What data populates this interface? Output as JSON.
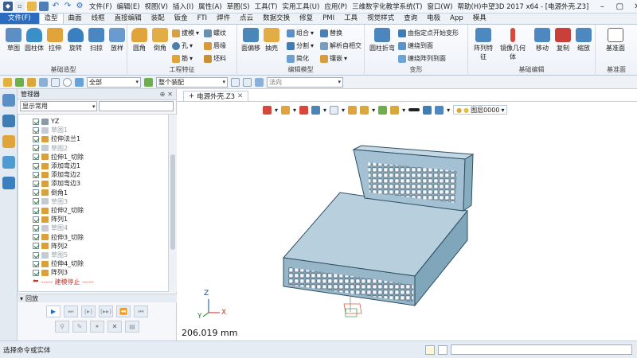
{
  "titlebar": {
    "menus": [
      "文件(F)",
      "编辑(E)",
      "视图(V)",
      "插入(I)",
      "属性(A)",
      "草图(S)",
      "工具(T)",
      "实用工具(U)",
      "应用(P)",
      "三维数字化教学系统(T)",
      "窗口(W)",
      "帮助(H)"
    ],
    "app_title": "中望3D 2017  x64 - [电源外壳.Z3]"
  },
  "tabs": {
    "file": "文件(F)",
    "items": [
      "造型",
      "曲面",
      "线框",
      "直接编辑",
      "装配",
      "钣金",
      "FTI",
      "焊件",
      "点云",
      "数据交换",
      "修复",
      "PMI",
      "工具",
      "视觉样式",
      "查询",
      "电极",
      "App",
      "模具"
    ],
    "active_index": 0
  },
  "ribbon": {
    "basic": {
      "label": "基础造型",
      "buttons": [
        "草图",
        "圆柱体",
        "拉伸",
        "旋转",
        "扫掠",
        "放样"
      ]
    },
    "engineering": {
      "label": "工程特征",
      "big_buttons": [
        "圆角",
        "倒角"
      ],
      "small_buttons": [
        "拔模",
        "孔",
        "筋",
        "螺纹",
        "唇缘",
        "坯料"
      ]
    },
    "edit": {
      "label": "编辑模型",
      "big_buttons": [
        "面偏移",
        "抽壳"
      ],
      "small_buttons": [
        "组合",
        "分割",
        "简化",
        "替换",
        "解析自相交",
        "镶嵌"
      ]
    },
    "transform": {
      "label": "变形",
      "big_buttons": [
        "圆柱折弯"
      ],
      "small_buttons": [
        "由指定点开始变形",
        "缠绕到面",
        "缠绕阵列到面"
      ]
    },
    "basic_edit": {
      "label": "基础编辑",
      "buttons": [
        "阵列特征",
        "镜像几何体",
        "移动",
        "复制",
        "缩放"
      ]
    },
    "datum": {
      "label": "基准面",
      "buttons": [
        "基准面"
      ]
    }
  },
  "toolbar": {
    "filter_combo": "全部",
    "assembly_combo": "整个装配",
    "method_combo": "法向"
  },
  "manager": {
    "title": "管理器",
    "display_combo": "显示常用",
    "tree": [
      {
        "label": "YZ",
        "type": "plane"
      },
      {
        "label": "草图1",
        "type": "sketch"
      },
      {
        "label": "拉伸法兰1",
        "type": "feature"
      },
      {
        "label": "草图2",
        "type": "sketch"
      },
      {
        "label": "拉伸1_切除",
        "type": "feature"
      },
      {
        "label": "添加弯边1",
        "type": "feature"
      },
      {
        "label": "添加弯边2",
        "type": "feature"
      },
      {
        "label": "添加弯边3",
        "type": "feature"
      },
      {
        "label": "倒角1",
        "type": "feature"
      },
      {
        "label": "草图3",
        "type": "sketch"
      },
      {
        "label": "拉伸2_切除",
        "type": "feature"
      },
      {
        "label": "阵列1",
        "type": "feature"
      },
      {
        "label": "草图4",
        "type": "sketch"
      },
      {
        "label": "拉伸3_切除",
        "type": "feature"
      },
      {
        "label": "阵列2",
        "type": "feature"
      },
      {
        "label": "草图5",
        "type": "sketch"
      },
      {
        "label": "拉伸4_切除",
        "type": "feature"
      },
      {
        "label": "阵列3",
        "type": "feature"
      }
    ],
    "stop_label": "----- 建模停止 -----"
  },
  "playback": {
    "title": "回放"
  },
  "viewport": {
    "doc_tab": "电源外壳.Z3",
    "layer": "图层0000",
    "scale_readout": "206.019 mm",
    "axis_labels": {
      "x": "X",
      "y": "Y",
      "z": "Z"
    }
  },
  "status": {
    "message": "选择命令或实体"
  },
  "colors": {
    "accent": "#2a6cbf",
    "model_face": "#a9c6d8",
    "model_top": "#b9d4e3",
    "model_side": "#7ea8c0",
    "model_edge": "#2f4f63"
  }
}
